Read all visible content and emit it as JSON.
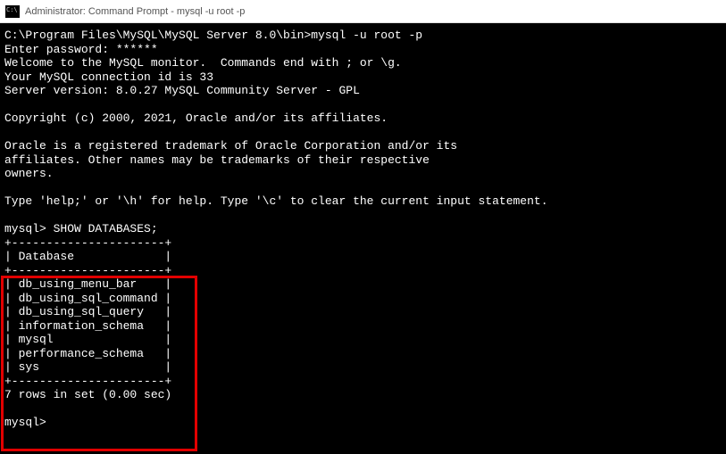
{
  "window": {
    "title": "Administrator: Command Prompt - mysql  -u root -p"
  },
  "terminal": {
    "line01": "C:\\Program Files\\MySQL\\MySQL Server 8.0\\bin>mysql -u root -p",
    "line02": "Enter password: ******",
    "line03": "Welcome to the MySQL monitor.  Commands end with ; or \\g.",
    "line04": "Your MySQL connection id is 33",
    "line05": "Server version: 8.0.27 MySQL Community Server - GPL",
    "line06": "",
    "line07": "Copyright (c) 2000, 2021, Oracle and/or its affiliates.",
    "line08": "",
    "line09": "Oracle is a registered trademark of Oracle Corporation and/or its",
    "line10": "affiliates. Other names may be trademarks of their respective",
    "line11": "owners.",
    "line12": "",
    "line13": "Type 'help;' or '\\h' for help. Type '\\c' to clear the current input statement.",
    "line14": "",
    "line15": "mysql> SHOW DATABASES;",
    "line16": "+----------------------+",
    "line17": "| Database             |",
    "line18": "+----------------------+",
    "line19": "| db_using_menu_bar    |",
    "line20": "| db_using_sql_command |",
    "line21": "| db_using_sql_query   |",
    "line22": "| information_schema   |",
    "line23": "| mysql                |",
    "line24": "| performance_schema   |",
    "line25": "| sys                  |",
    "line26": "+----------------------+",
    "line27": "7 rows in set (0.00 sec)",
    "line28": "",
    "line29": "mysql>"
  }
}
